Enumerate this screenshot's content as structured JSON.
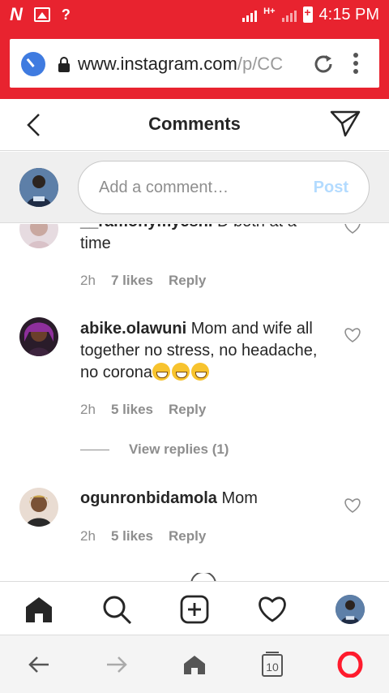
{
  "status_bar": {
    "time": "4:15 PM",
    "network_label": "H+",
    "left_icons": [
      "n-notification-icon",
      "image-notification-icon",
      "no-signal-icon"
    ],
    "right_icons": [
      "signal-icon",
      "battery-charging-icon"
    ]
  },
  "browser": {
    "url_host": "www.instagram.com",
    "url_path": "/p/CC",
    "icons": [
      "speed-dial-icon",
      "lock-icon",
      "reload-icon",
      "menu-icon"
    ]
  },
  "header": {
    "title": "Comments",
    "back_icon": "chevron-left-icon",
    "share_icon": "send-icon"
  },
  "comment_input": {
    "placeholder": "Add a comment…",
    "post_label": "Post",
    "post_color": "#b3dbff"
  },
  "comments": [
    {
      "username": "__ramohymyeshi",
      "text": "time",
      "text_partial": "D both at a",
      "time": "2h",
      "likes": "7 likes",
      "reply": "Reply"
    },
    {
      "username": "abike.olawuni",
      "text": "Mom and wife all together no stress, no headache, no corona",
      "time": "2h",
      "likes": "5 likes",
      "reply": "Reply",
      "view_replies": "View replies (1)"
    },
    {
      "username": "ogunronbidamola",
      "text": "Mom",
      "time": "2h",
      "likes": "5 likes",
      "reply": "Reply"
    }
  ],
  "ig_nav": [
    "home-icon",
    "search-icon",
    "new-post-icon",
    "activity-heart-icon",
    "profile-avatar"
  ],
  "browser_bottom": {
    "tab_count": "10",
    "items": [
      "back-arrow-icon",
      "forward-arrow-icon",
      "home-icon",
      "tabs-icon",
      "opera-menu-icon"
    ]
  },
  "colors": {
    "accent_red": "#e8232f",
    "text": "#262626",
    "muted": "#8e8e8e",
    "opera_red": "#ff1b2d"
  }
}
